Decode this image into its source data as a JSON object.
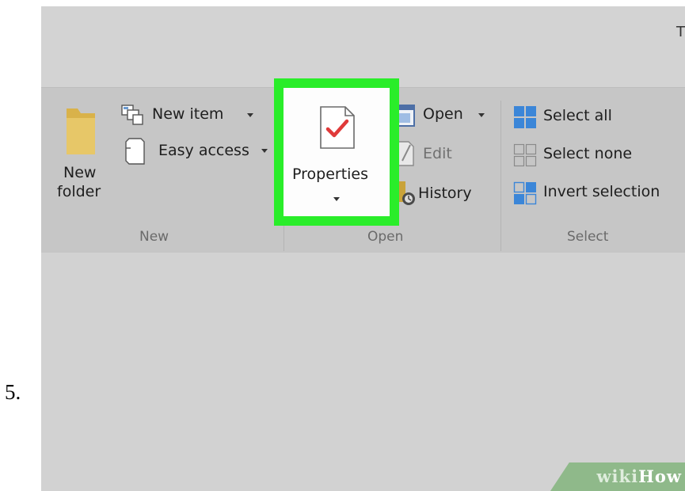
{
  "step": {
    "number": "5."
  },
  "window": {
    "title_glyph": "T"
  },
  "ribbon": {
    "new_group": {
      "label": "New",
      "new_folder": {
        "line1": "New",
        "line2": "folder"
      },
      "new_item": "New item",
      "easy_access": "Easy access"
    },
    "open_group": {
      "label": "Open",
      "properties": "Properties",
      "open": "Open",
      "edit": "Edit",
      "history": "History"
    },
    "select_group": {
      "label": "Select",
      "select_all": "Select all",
      "select_none": "Select none",
      "invert_selection": "Invert selection"
    }
  },
  "highlight_color": "#2aed2a",
  "watermark": {
    "brand_wiki": "wiki",
    "brand_how": "How"
  }
}
